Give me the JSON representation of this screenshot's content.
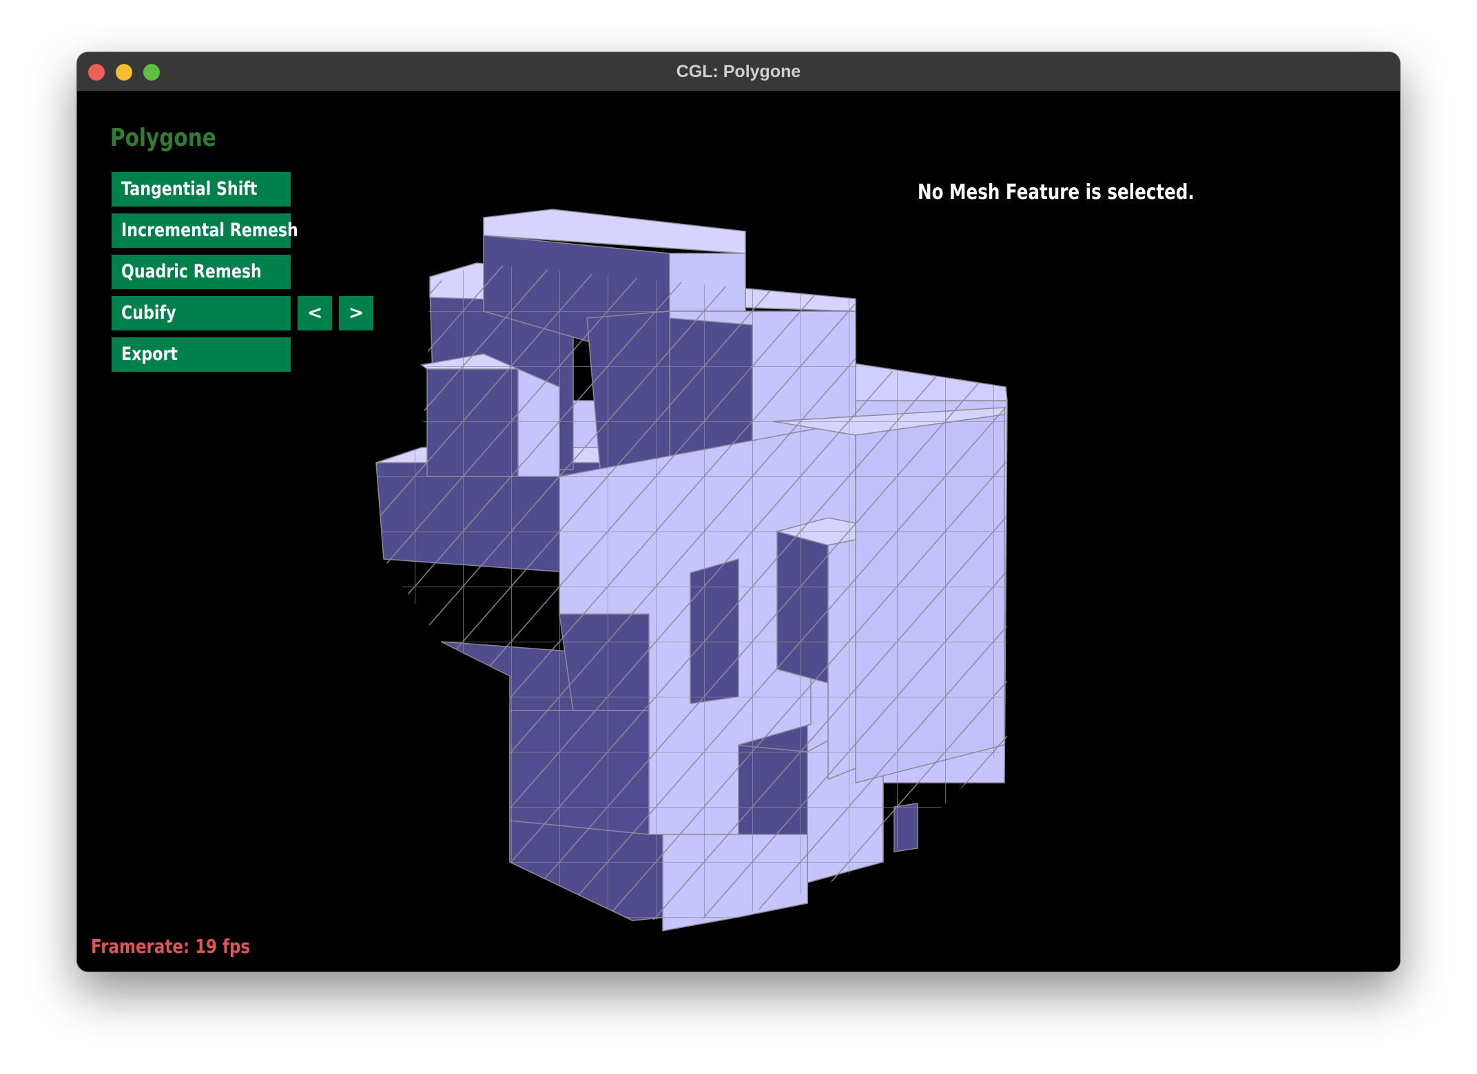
{
  "window": {
    "title": "CGL: Polygone"
  },
  "panel": {
    "app_title": "Polygone",
    "buttons": [
      {
        "label": "Tangential Shift"
      },
      {
        "label": "Incremental Remesh"
      },
      {
        "label": "Quadric Remesh"
      },
      {
        "label": "Cubify"
      },
      {
        "label": "Export"
      }
    ],
    "prev_label": "<",
    "next_label": ">"
  },
  "status": {
    "selection": "No Mesh Feature is selected.",
    "framerate": "Framerate: 19 fps"
  },
  "colors": {
    "button_bg": "#00804a",
    "title_green": "#2e7d32",
    "fps_red": "#e05555",
    "mesh_light": "#c6c4fc",
    "mesh_dark": "#504c8e",
    "wire": "#8a8a96"
  }
}
